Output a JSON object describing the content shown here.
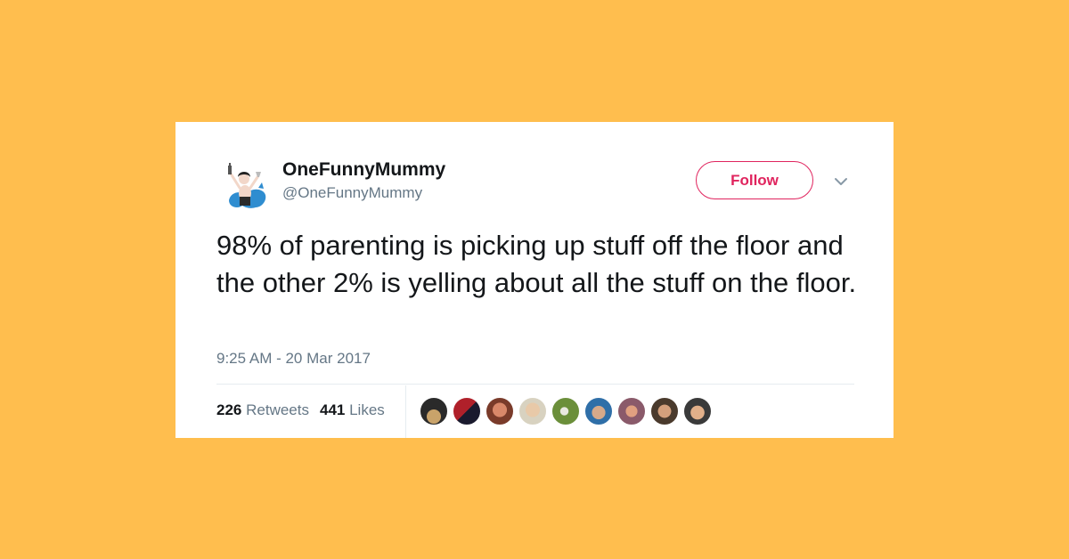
{
  "tweet": {
    "display_name": "OneFunnyMummy",
    "handle": "@OneFunnyMummy",
    "follow_label": "Follow",
    "text": "98% of parenting is picking up stuff off the floor and the other 2% is yelling about all the stuff on the floor.",
    "timestamp": "9:25 AM - 20 Mar 2017",
    "retweets_count": "226",
    "retweets_label": "Retweets",
    "likes_count": "441",
    "likes_label": "Likes"
  },
  "colors": {
    "background": "#FFBE4E",
    "follow_accent": "#e0245e",
    "secondary_text": "#657786"
  },
  "icons": {
    "more_menu": "chevron-down-icon",
    "liker_avatars": [
      "avatar",
      "avatar",
      "avatar",
      "avatar",
      "avatar",
      "avatar",
      "avatar",
      "avatar",
      "avatar"
    ]
  }
}
